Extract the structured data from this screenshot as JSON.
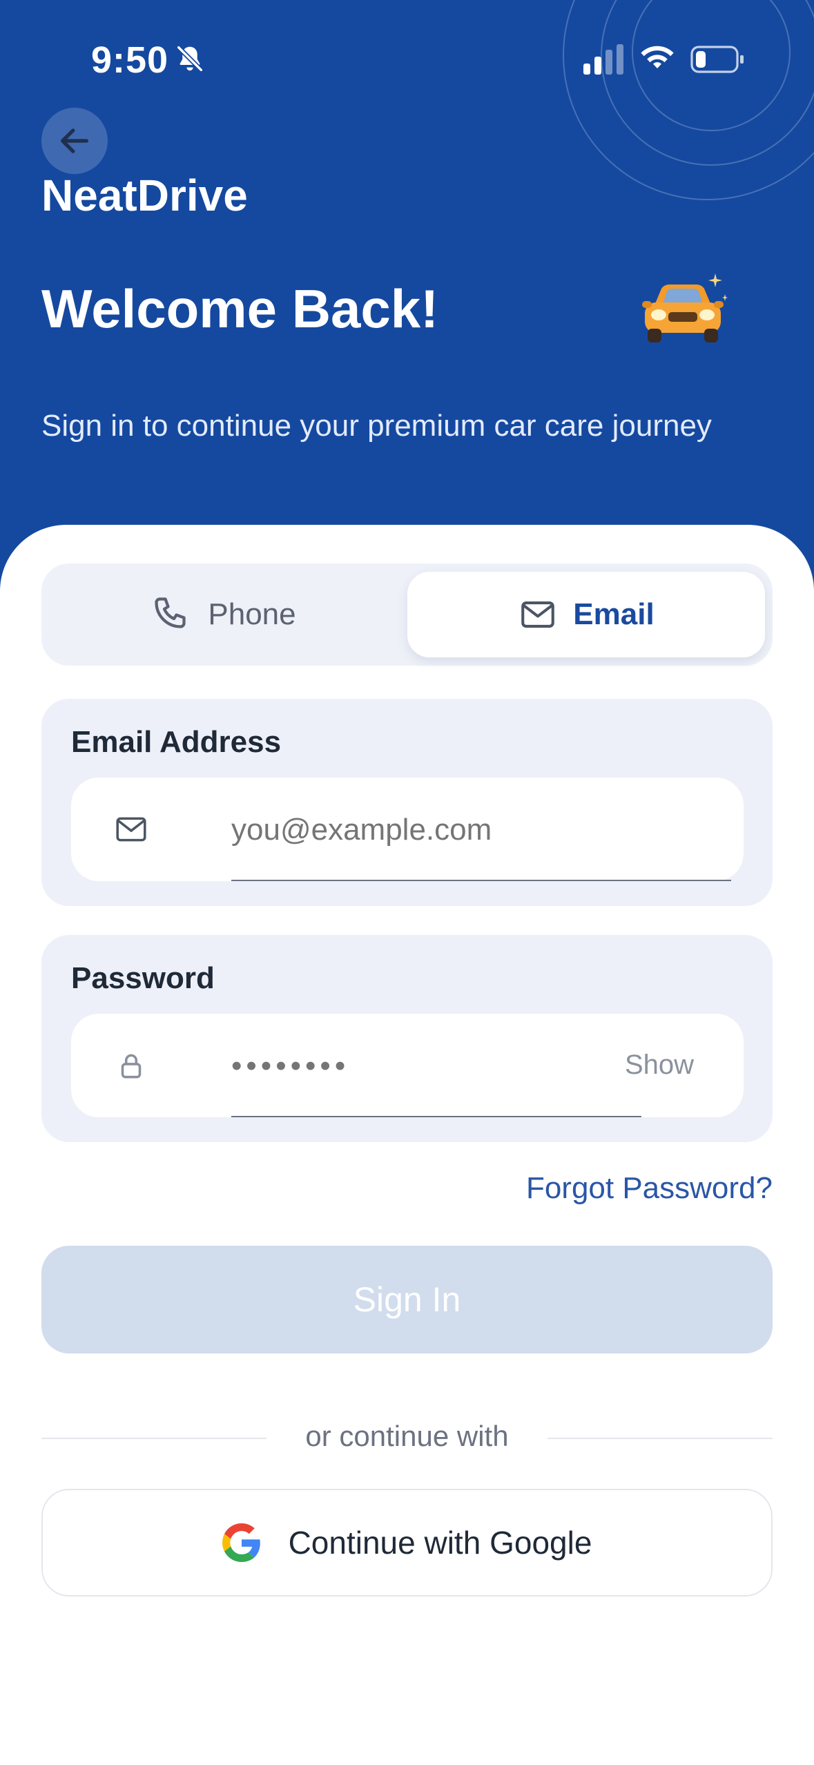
{
  "status_bar": {
    "time": "9:50",
    "icons": [
      "bell-slash-icon",
      "cellular-signal-icon",
      "wifi-icon",
      "battery-icon"
    ]
  },
  "header": {
    "back_icon": "arrow-left-icon",
    "brand": "NeatDrive",
    "title": "Welcome Back!",
    "emoji_icon": "car-icon",
    "subtitle": "Sign in to continue your premium car care journey"
  },
  "login_method": {
    "tabs": [
      {
        "label": "Phone",
        "icon": "phone-icon",
        "selected": false
      },
      {
        "label": "Email",
        "icon": "mail-icon",
        "selected": true
      }
    ]
  },
  "form": {
    "email": {
      "label": "Email Address",
      "placeholder": "you@example.com",
      "value": "",
      "icon": "mail-icon"
    },
    "password": {
      "label": "Password",
      "placeholder": "••••••••",
      "value": "",
      "icon": "lock-icon",
      "toggle_label": "Show"
    },
    "forgot_label": "Forgot Password?",
    "submit_label": "Sign In"
  },
  "alt_login": {
    "divider_text": "or continue with",
    "google_label": "Continue with Google",
    "google_icon": "google-icon"
  },
  "colors": {
    "brand_blue": "#1549a0",
    "accent_text": "#1a4aa0",
    "disabled_button": "#d1dced",
    "card_bg": "#edf0f8"
  }
}
